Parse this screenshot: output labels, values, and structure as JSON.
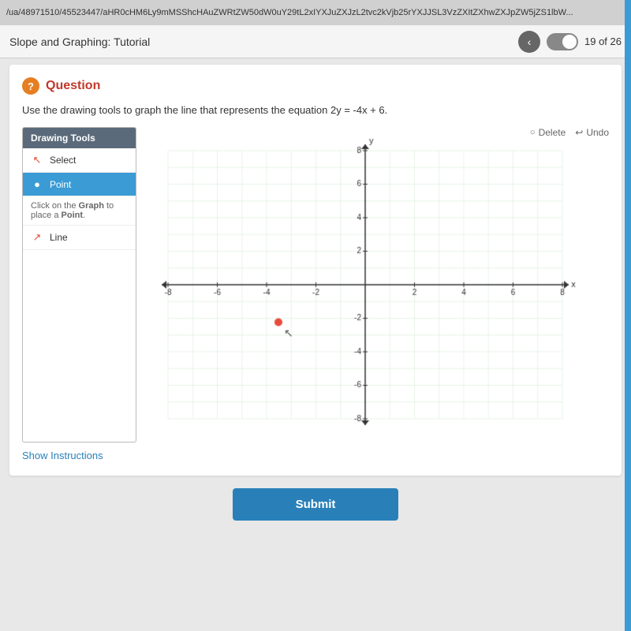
{
  "url_bar": {
    "text": "/ua/48971510/45523447/aHR0cHM6Ly9mMSShcHAuZWRtZW50dW0uY29tL2xIYXJuZXJzL2tvc2kVjb25rYXJJSL3VzZXItZXhwZXJpZW5jZS1lbW..."
  },
  "header": {
    "title": "Slope and Graphing: Tutorial",
    "page_info": "19 of 26",
    "nav_back": "‹"
  },
  "question": {
    "icon": "?",
    "label": "Question",
    "text": "Use the drawing tools to graph the line that represents the equation 2y = -4x + 6."
  },
  "drawing_tools": {
    "header": "Drawing Tools",
    "tools": [
      {
        "id": "select",
        "label": "Select",
        "icon": "↖",
        "active": false
      },
      {
        "id": "point",
        "label": "Point",
        "icon": "●",
        "active": true
      },
      {
        "id": "line",
        "label": "Line",
        "icon": "↗",
        "active": false
      }
    ],
    "hint": "Click on the Graph to place a Point."
  },
  "graph": {
    "delete_label": "Delete",
    "undo_label": "Undo",
    "x_min": -8,
    "x_max": 8,
    "y_min": -8,
    "y_max": 8
  },
  "footer": {
    "show_instructions": "Show Instructions"
  },
  "submit": {
    "label": "Submit"
  }
}
